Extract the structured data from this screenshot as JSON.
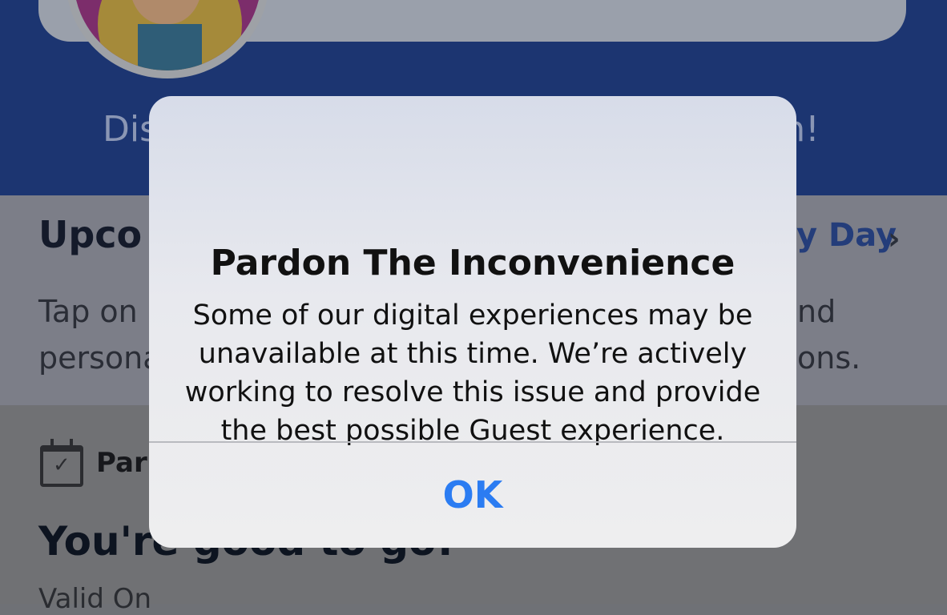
{
  "banner": {
    "text_left": "Dis",
    "text_right": "th!"
  },
  "upcoming": {
    "title": "Upco",
    "my_day_link": "y Day",
    "text_left_line1": "Tap on",
    "text_left_line2": "persona",
    "text_right_line1": "nd",
    "text_right_line2": "ons."
  },
  "park": {
    "label": "Park",
    "status_title": "You're good to go!",
    "valid_on": "Valid On"
  },
  "alert": {
    "title": "Pardon The Inconvenience",
    "message": "Some of our digital experiences may be unavailable at this time. We’re actively working to resolve this issue and provide the best possible Guest experience.",
    "ok_label": "OK"
  },
  "colors": {
    "accent": "#2b7cf2",
    "banner": "#1c3571"
  }
}
